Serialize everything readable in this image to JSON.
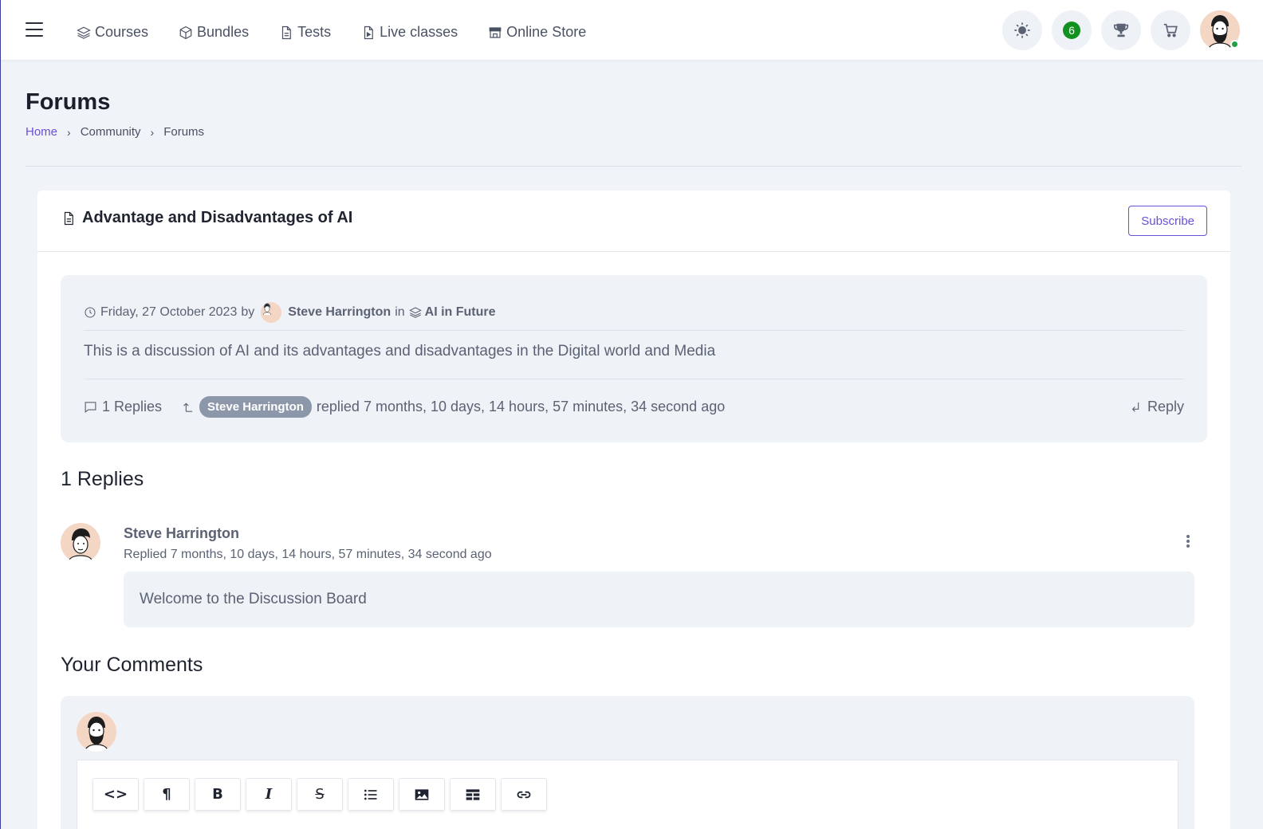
{
  "nav": {
    "items": [
      {
        "label": "Courses",
        "icon": "layers-icon"
      },
      {
        "label": "Bundles",
        "icon": "box-icon"
      },
      {
        "label": "Tests",
        "icon": "document-icon"
      },
      {
        "label": "Live classes",
        "icon": "document-icon"
      },
      {
        "label": "Online Store",
        "icon": "store-icon"
      }
    ]
  },
  "header_actions": {
    "notification_count": "6",
    "icons": [
      "sun-icon",
      "notification-badge",
      "trophy-icon",
      "cart-icon",
      "avatar"
    ]
  },
  "page": {
    "title": "Forums",
    "breadcrumb": [
      "Home",
      "Community",
      "Forums"
    ]
  },
  "topic": {
    "title": "Advantage and Disadvantages of AI",
    "subscribe_label": "Subscribe",
    "date": "Friday, 27 October 2023",
    "by_label": "by",
    "author": "Steve Harrington",
    "in_label": "in",
    "category": "AI in Future",
    "body": "This is a discussion of AI and its advantages and disadvantages in the Digital world and Media",
    "reply_count_label": "1 Replies",
    "last_replier": "Steve Harrington",
    "last_reply_text": "replied 7 months, 10 days, 14 hours, 57 minutes, 34 second ago",
    "reply_button": "Reply"
  },
  "replies": {
    "heading": "1 Replies",
    "items": [
      {
        "author": "Steve Harrington",
        "time": "Replied 7 months, 10 days, 14 hours, 57 minutes, 34 second ago",
        "body": "Welcome to the Discussion Board"
      }
    ]
  },
  "comments": {
    "heading": "Your Comments",
    "toolbar": [
      {
        "label": "<>",
        "name": "code-button"
      },
      {
        "label": "¶",
        "name": "paragraph-button"
      },
      {
        "label": "B",
        "name": "bold-button"
      },
      {
        "label": "I",
        "name": "italic-button"
      },
      {
        "label": "S",
        "name": "strikethrough-button"
      },
      {
        "label": "",
        "name": "list-button"
      },
      {
        "label": "",
        "name": "image-button"
      },
      {
        "label": "",
        "name": "table-button"
      },
      {
        "label": "",
        "name": "link-button"
      }
    ]
  },
  "colors": {
    "accent": "#6c4fd8",
    "background": "#f0f3f8",
    "badge_green": "#11911f",
    "pill": "#8d97aa",
    "online": "#24a148"
  }
}
